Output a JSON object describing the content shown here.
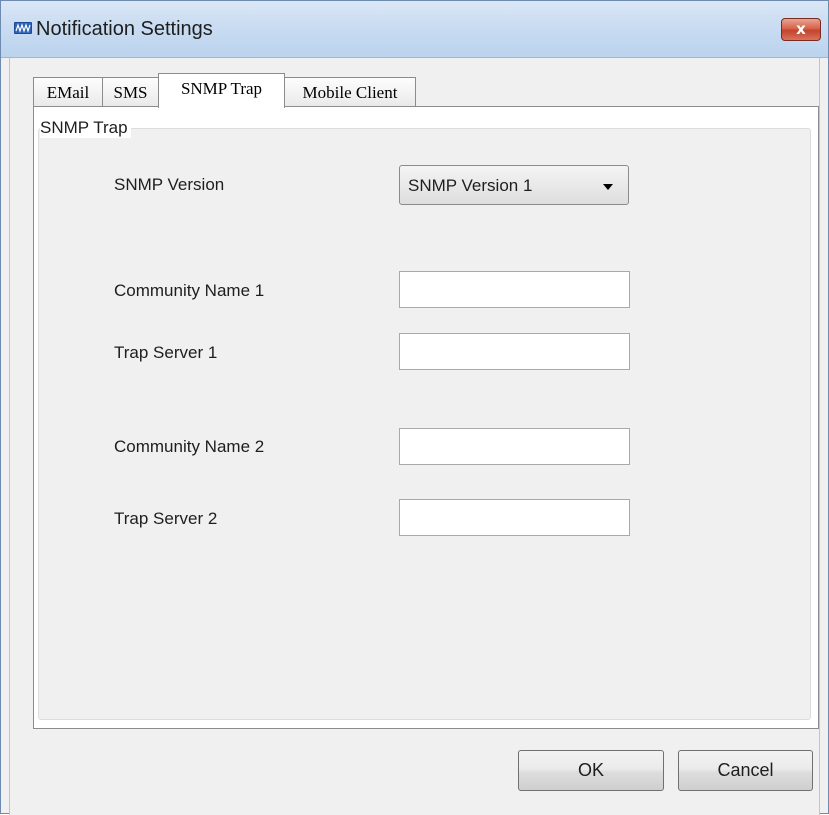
{
  "window": {
    "title": "Notification Settings",
    "close_label": "x",
    "icon": "app-logo-icon"
  },
  "tabs": [
    {
      "label": "EMail",
      "active": false
    },
    {
      "label": "SMS",
      "active": false
    },
    {
      "label": "SNMP Trap",
      "active": true
    },
    {
      "label": "Mobile Client",
      "active": false
    }
  ],
  "group": {
    "title": "SNMP Trap"
  },
  "fields": {
    "snmp_version": {
      "label": "SNMP Version",
      "value": "SNMP Version 1"
    },
    "community_name_1": {
      "label": "Community Name 1",
      "value": ""
    },
    "trap_server_1": {
      "label": "Trap Server 1",
      "value": ""
    },
    "community_name_2": {
      "label": "Community Name 2",
      "value": ""
    },
    "trap_server_2": {
      "label": "Trap Server 2",
      "value": ""
    }
  },
  "buttons": {
    "ok": "OK",
    "cancel": "Cancel"
  }
}
